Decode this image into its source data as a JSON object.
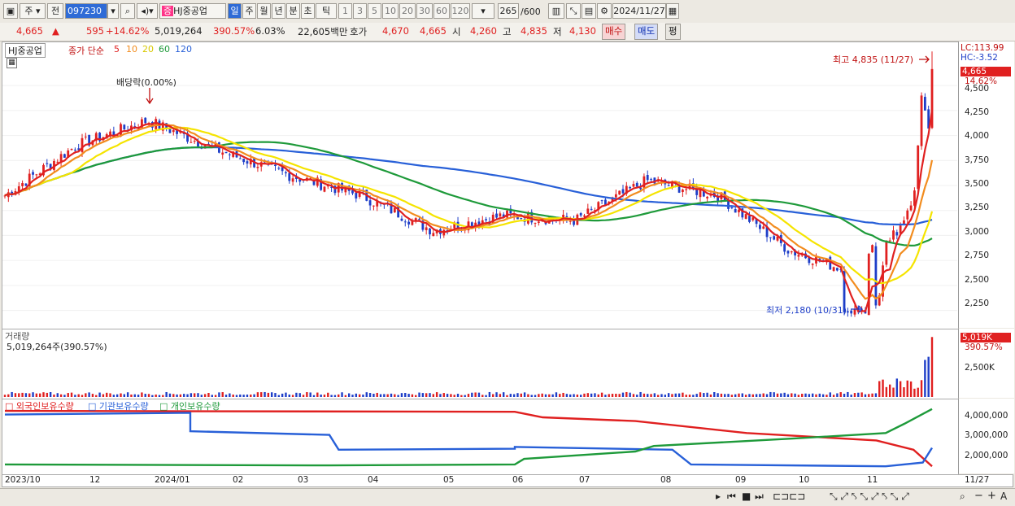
{
  "toolbar": {
    "mode1": "주",
    "mode2": "전",
    "code": "097230",
    "name": "HJ중공업",
    "periods": [
      "일",
      "주",
      "월",
      "년",
      "분",
      "초",
      "틱"
    ],
    "nums": [
      "1",
      "3",
      "5",
      "10",
      "20",
      "30",
      "60",
      "120"
    ],
    "count": "265",
    "count_total": "/600",
    "date": "2024/11/27"
  },
  "quote": {
    "price": "4,665",
    "arrow": "▲",
    "change": "595",
    "change_pct": "+14.62%",
    "volume": "5,019,264",
    "vol_pct": "390.57%",
    "turnover": "6.03%",
    "amount": "22,605백만",
    "ask_label": "호가",
    "ask": "4,670",
    "bid": "4,665",
    "open_label": "시",
    "open": "4,260",
    "high_label": "고",
    "high": "4,835",
    "low_label": "저",
    "low": "4,130",
    "buy_btn": "매수",
    "sell_btn": "매도",
    "eval_btn": "평"
  },
  "legend": {
    "stock": "HJ중공업",
    "ma_prefix": "종가 단순",
    "ma": [
      {
        "label": "5",
        "color": "#e02020"
      },
      {
        "label": "10",
        "color": "#f28c1e"
      },
      {
        "label": "20",
        "color": "#f5e400"
      },
      {
        "label": "60",
        "color": "#1e9a3a"
      },
      {
        "label": "120",
        "color": "#2860d8"
      }
    ]
  },
  "annotations": {
    "dividend": "배당락(0.00%)",
    "max": "최고 4,835 (11/27)",
    "min": "최저 2,180 (10/31)"
  },
  "price_axis": {
    "lc": "LC:113.99",
    "hc": "HC:-3.52",
    "current": "4,665",
    "current_pct": "14.62%",
    "ticks": [
      "4,500",
      "4,250",
      "4,000",
      "3,750",
      "3,500",
      "3,250",
      "3,000",
      "2,750",
      "2,500",
      "2,250"
    ]
  },
  "volume_panel": {
    "title": "거래량",
    "info": "5,019,264주(390.57%)",
    "axis_current": "5,019K",
    "axis_pct": "390.57%",
    "tick": "2,500K"
  },
  "holdings_panel": {
    "legend": [
      "외국인보유수량",
      "기관보유수량",
      "개인보유수량"
    ],
    "ticks": [
      "4,000,000",
      "3,000,000",
      "2,000,000"
    ]
  },
  "x_axis": [
    "2023/10",
    "12",
    "2024/01",
    "02",
    "03",
    "04",
    "05",
    "06",
    "07",
    "08",
    "09",
    "10",
    "11"
  ],
  "x_axis_last": "11/27",
  "colors": {
    "up": "#e02020",
    "down": "#1e3ec8",
    "foreign": "#e02020",
    "institution": "#2860d8",
    "individual": "#1e9a3a"
  },
  "chart_data": {
    "type": "candlestick",
    "price_ylim": [
      2100,
      4900
    ],
    "dates": [
      "2023/10",
      "2023/11",
      "2023/12",
      "2024/01",
      "2024/02",
      "2024/03",
      "2024/04",
      "2024/05",
      "2024/06",
      "2024/07",
      "2024/08",
      "2024/09",
      "2024/10",
      "2024/11"
    ],
    "close": [
      3400,
      3900,
      4150,
      3850,
      3600,
      3400,
      3050,
      3200,
      3150,
      3550,
      3400,
      2850,
      2600,
      4665
    ],
    "high_point": {
      "date": "11/27",
      "value": 4835
    },
    "low_point": {
      "date": "10/31",
      "value": 2180
    },
    "ma120_end": 3000,
    "ma60_end": 2750,
    "volume_last": 5019264,
    "holdings": {
      "foreign_start": 4300000,
      "foreign_end": 1300000,
      "institution_start": 4200000,
      "institution_end": 2300000,
      "individual_start": 1400000,
      "individual_end": 4400000
    }
  }
}
